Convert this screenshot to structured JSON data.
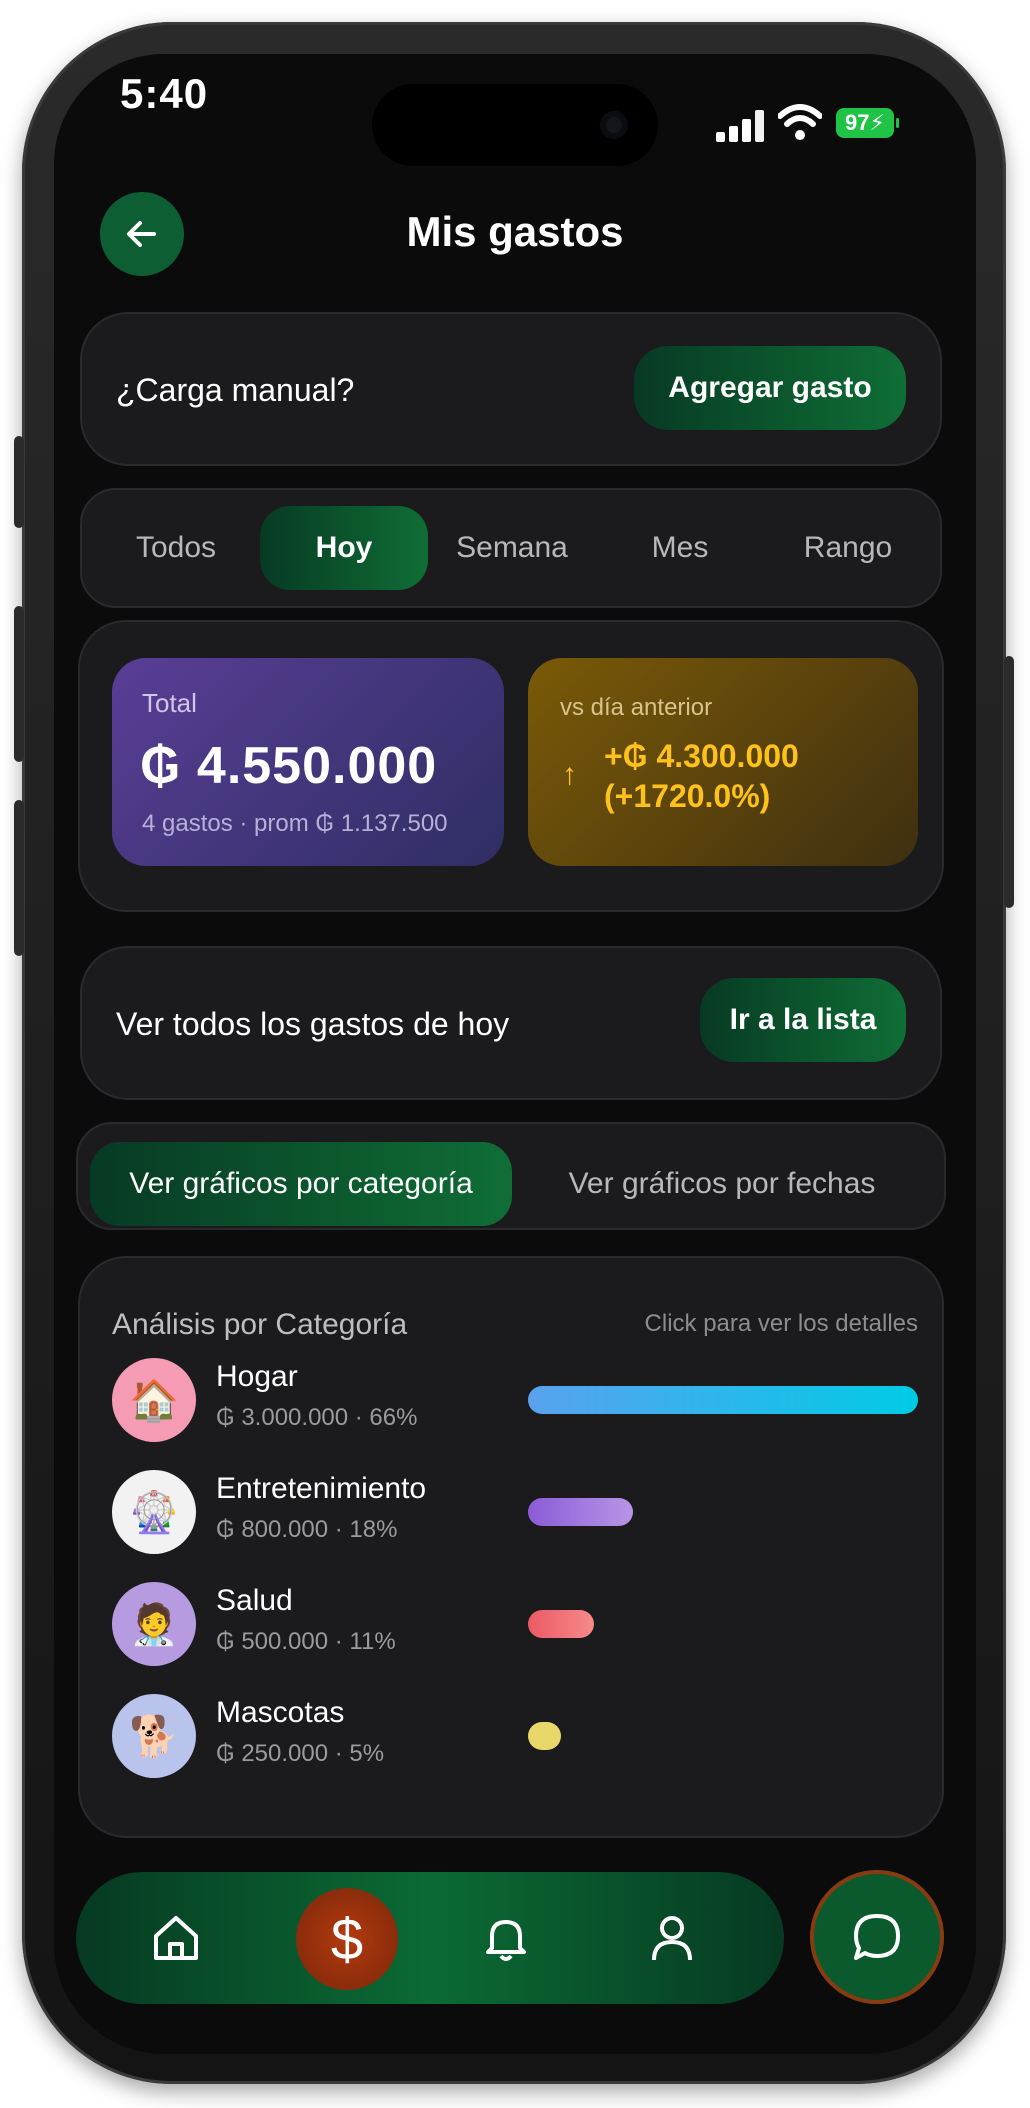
{
  "status_bar": {
    "time": "5:40",
    "battery": "97"
  },
  "header": {
    "title": "Mis gastos",
    "back_icon": "arrow-left-icon"
  },
  "manual": {
    "label": "¿Carga manual?",
    "button": "Agregar gasto"
  },
  "period_tabs": [
    {
      "label": "Todos",
      "active": false
    },
    {
      "label": "Hoy",
      "active": true
    },
    {
      "label": "Semana",
      "active": false
    },
    {
      "label": "Mes",
      "active": false
    },
    {
      "label": "Rango",
      "active": false
    }
  ],
  "summary": {
    "total_label": "Total",
    "total_amount": "₲ 4.550.000",
    "total_sub": "4 gastos · prom ₲ 1.137.500",
    "compare_label": "vs día anterior",
    "compare_arrow": "↑",
    "compare_value_line1": "+₲ 4.300.000",
    "compare_value_line2": "(+1720.0%)"
  },
  "list_row": {
    "label": "Ver todos los gastos de hoy",
    "button": "Ir a la lista"
  },
  "chart_toggle": [
    {
      "label": "Ver gráficos por categoría",
      "active": true
    },
    {
      "label": "Ver gráficos por fechas",
      "active": false
    }
  ],
  "analysis": {
    "title": "Análisis por Categoría",
    "hint": "Click para ver los detalles",
    "categories": [
      {
        "name": "Hogar",
        "amount": "₲ 3.000.000 · 66%",
        "share": 1.0,
        "icon": "house-icon",
        "glyph": "🏠",
        "avatar_color": "#f59bb4",
        "bar_color": "linear-gradient(90deg,#5aa2ee,#00cbe6)"
      },
      {
        "name": "Entretenimiento",
        "amount": "₲ 800.000 · 18%",
        "share": 0.27,
        "icon": "ferris-wheel-icon",
        "glyph": "🎡",
        "avatar_color": "#f2f2f2",
        "bar_color": "linear-gradient(90deg,#8b5cd6,#b894e6)"
      },
      {
        "name": "Salud",
        "amount": "₲ 500.000 · 11%",
        "share": 0.17,
        "icon": "doctor-icon",
        "glyph": "🧑‍⚕️",
        "avatar_color": "#b79be0",
        "bar_color": "linear-gradient(90deg,#ec5a64,#f58a8a)"
      },
      {
        "name": "Mascotas",
        "amount": "₲ 250.000 · 5%",
        "share": 0.085,
        "icon": "dog-icon",
        "glyph": "🐕",
        "avatar_color": "#b9c4ec",
        "bar_color": "#e8d869"
      }
    ]
  },
  "bottom_nav": {
    "items": [
      "home-icon",
      "dollar-icon",
      "bell-icon",
      "user-icon"
    ],
    "dollar_glyph": "$",
    "chat_icon": "chat-bubble-icon"
  }
}
